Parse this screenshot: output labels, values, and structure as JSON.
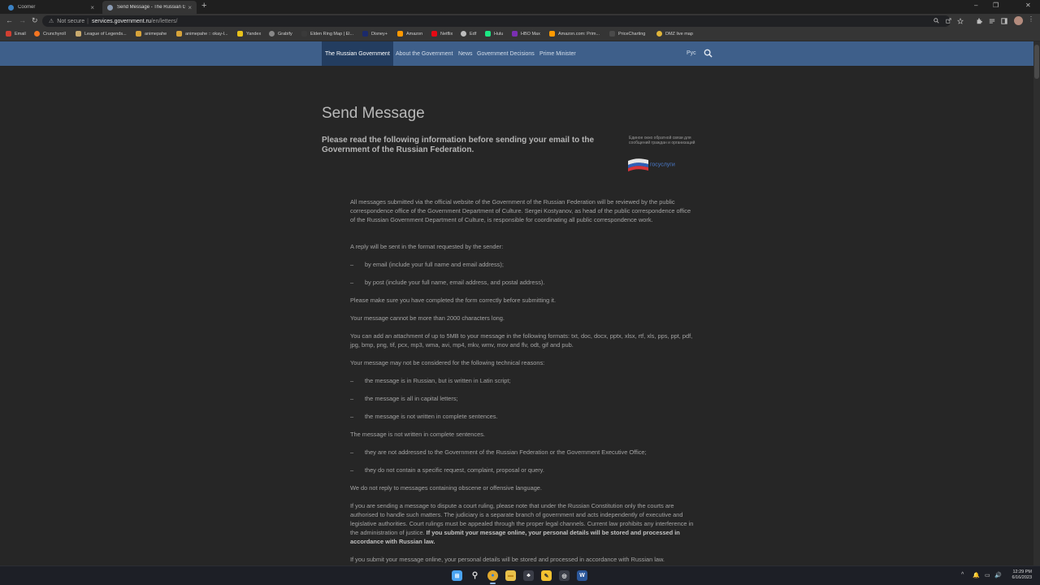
{
  "browser": {
    "tabs": [
      {
        "title": "Coomer",
        "favicon_color": "#3b82c4"
      },
      {
        "title": "Send Message - The Russian Gov",
        "favicon_color": "#8a9bb3"
      }
    ],
    "tab_close": "×",
    "new_tab": "+",
    "window_controls": [
      "–",
      "❐",
      "✕"
    ],
    "nav": {
      "back": "←",
      "forward": "→",
      "reload": "↻"
    },
    "address": {
      "security_label": "Not secure",
      "security_icon": "⚠",
      "separator": "|",
      "host": "services.government.ru",
      "path": "/en/letters/"
    },
    "toolbar_icons": [
      "search-icon",
      "share-icon",
      "star-icon",
      "extensions-icon",
      "reading-list-icon",
      "sidebar-icon"
    ],
    "bookmarks": [
      {
        "label": "Email",
        "color": "#d23f31"
      },
      {
        "label": "Crunchyroll",
        "color": "#f47521"
      },
      {
        "label": "League of Legends...",
        "color": "#c8aa6e"
      },
      {
        "label": "animepahe",
        "color": "#d6a33a"
      },
      {
        "label": "animepahe :: okay-l...",
        "color": "#d6a33a"
      },
      {
        "label": "Yandex",
        "color": "#e8c21b"
      },
      {
        "label": "Grabify",
        "color": "#888888"
      },
      {
        "label": "Elden Ring Map | El...",
        "color": "#3a3a3a"
      },
      {
        "label": "Disney+",
        "color": "#1b2a6b"
      },
      {
        "label": "Amazon",
        "color": "#ff9900"
      },
      {
        "label": "Netflix",
        "color": "#e50914"
      },
      {
        "label": "Edf",
        "color": "#bdbdbd"
      },
      {
        "label": "Hulu",
        "color": "#1ce783"
      },
      {
        "label": "HBO Max",
        "color": "#7a2fb3"
      },
      {
        "label": "Amazon.com: Prim...",
        "color": "#ff9900"
      },
      {
        "label": "PriceCharting",
        "color": "#4a4a4a"
      },
      {
        "label": "DMZ live map",
        "color": "#e0b53a"
      }
    ]
  },
  "site_nav": {
    "items": [
      "The Russian Government",
      "About the Government",
      "News",
      "Government Decisions",
      "Prime Minister"
    ],
    "language": "Рус"
  },
  "page": {
    "title": "Send Message",
    "lead": "Please read the following information before sending your email to the Government of the Russian Federation.",
    "gosuslugi_caption": "Единое окно обратной связи для сообщений граждан и организаций",
    "gosuslugi_brand": "госуслуги",
    "paragraphs": [
      {
        "type": "p",
        "text": "All messages submitted via the official website of the Government of the Russian Federation will be reviewed by the public correspondence office of the Government Department of Culture. Sergei Kostyanov, as head of the public correspondence office of the Russian Government Department of Culture, is responsible for coordinating all public correspondence work."
      },
      {
        "type": "p",
        "text": "A reply will be sent in the format requested by the sender:"
      },
      {
        "type": "li",
        "text": "by email (include your full name and email address);"
      },
      {
        "type": "li",
        "text": "by post (include your full name, email address, and postal address)."
      },
      {
        "type": "p",
        "text": "Please make sure you have completed the form correctly before submitting it."
      },
      {
        "type": "p",
        "text": "Your message cannot be more than 2000 characters long."
      },
      {
        "type": "p",
        "text": "You can add an attachment of up to 5MB to your message in the following formats: txt, doc, docx, pptx, xlsx, rtf, xls, pps, ppt, pdf, jpg, bmp, png, tif, pcx, mp3, wma, avi, mp4, mkv, wmv, mov and flv, odt, gif and pub."
      },
      {
        "type": "p",
        "text": "Your message may not be considered for the following technical reasons:"
      },
      {
        "type": "li",
        "text": "the message is in Russian, but is written in Latin script;"
      },
      {
        "type": "li",
        "text": "the message is all in capital letters;"
      },
      {
        "type": "li",
        "text": "the message is not written in complete sentences."
      },
      {
        "type": "p",
        "text": "The message is not written in complete sentences."
      },
      {
        "type": "li",
        "text": "they are not addressed to the Government of the Russian Federation or the Government Executive Office;"
      },
      {
        "type": "li",
        "text": "they do not contain a specific request, complaint, proposal or query."
      },
      {
        "type": "p",
        "text": "We do not reply to messages containing obscene or offensive language."
      },
      {
        "type": "p",
        "text": "If you are sending a message to dispute a court ruling, please note that under the Russian Constitution only the courts are authorised to handle such matters. The judiciary is a separate branch of government and acts independently of executive and legislative authorities. Court rulings must be appealed through the proper legal channels. Current law prohibits any interference in the administration of justice.",
        "bold": "If you submit your message online, your personal details will be stored and processed in accordance with Russian law."
      },
      {
        "type": "p",
        "text": "If you submit your message online, your personal details will be stored and processed in accordance with Russian law."
      }
    ],
    "list_dash": "–"
  },
  "taskbar": {
    "apps": [
      {
        "name": "windows-start-icon",
        "color": "#4aa3f0",
        "glyph": "⊞"
      },
      {
        "name": "search-icon",
        "color": "#1d1f26",
        "glyph": "⚲"
      },
      {
        "name": "chrome-icon",
        "color": "#e0a82e",
        "glyph": "●"
      },
      {
        "name": "file-explorer-icon",
        "color": "#e8c04a",
        "glyph": "▬"
      },
      {
        "name": "app-icon",
        "color": "#3a3d47",
        "glyph": "♣"
      },
      {
        "name": "notes-icon",
        "color": "#f2c230",
        "glyph": "✎"
      },
      {
        "name": "obs-icon",
        "color": "#3a3d47",
        "glyph": "◎"
      },
      {
        "name": "word-icon",
        "color": "#2b579a",
        "glyph": "W"
      }
    ],
    "tray": [
      "^",
      "🔔",
      "▭",
      "🔊"
    ],
    "time": "12:29 PM",
    "date": "6/16/2023"
  },
  "colors": {
    "site_nav": "#3e5f8a",
    "site_nav_active": "#233d60",
    "page_bg": "#262626"
  }
}
